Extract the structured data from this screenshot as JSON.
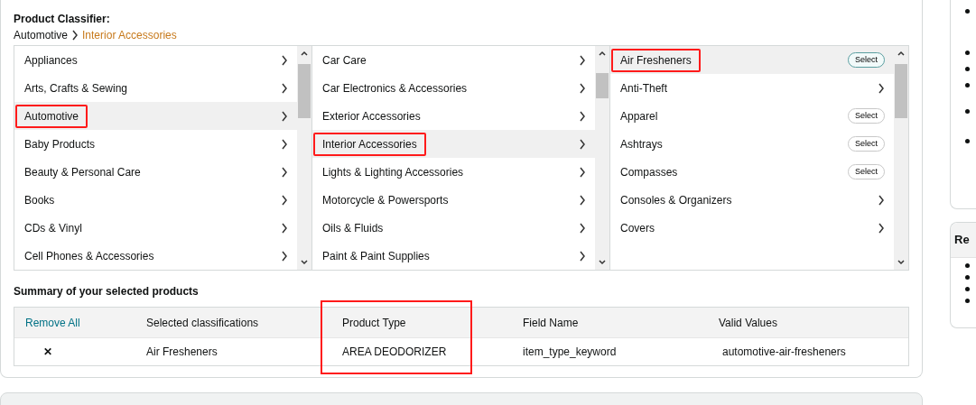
{
  "classifier": {
    "title": "Product Classifier:",
    "breadcrumb": [
      {
        "label": "Automotive",
        "current": false
      },
      {
        "label": "Interior Accessories",
        "current": true
      }
    ],
    "columns": [
      {
        "items": [
          {
            "label": "Appliances",
            "kind": "category",
            "selected": false,
            "highlighted": false
          },
          {
            "label": "Arts, Crafts & Sewing",
            "kind": "category",
            "selected": false,
            "highlighted": false
          },
          {
            "label": "Automotive",
            "kind": "category",
            "selected": true,
            "highlighted": true
          },
          {
            "label": "Baby Products",
            "kind": "category",
            "selected": false,
            "highlighted": false
          },
          {
            "label": "Beauty & Personal Care",
            "kind": "category",
            "selected": false,
            "highlighted": false
          },
          {
            "label": "Books",
            "kind": "category",
            "selected": false,
            "highlighted": false
          },
          {
            "label": "CDs & Vinyl",
            "kind": "category",
            "selected": false,
            "highlighted": false
          },
          {
            "label": "Cell Phones & Accessories",
            "kind": "category",
            "selected": false,
            "highlighted": false
          }
        ]
      },
      {
        "items": [
          {
            "label": "Car Care",
            "kind": "category",
            "selected": false,
            "highlighted": false
          },
          {
            "label": "Car Electronics & Accessories",
            "kind": "category",
            "selected": false,
            "highlighted": false
          },
          {
            "label": "Exterior Accessories",
            "kind": "category",
            "selected": false,
            "highlighted": false
          },
          {
            "label": "Interior Accessories",
            "kind": "category",
            "selected": true,
            "highlighted": true
          },
          {
            "label": "Lights & Lighting Accessories",
            "kind": "category",
            "selected": false,
            "highlighted": false
          },
          {
            "label": "Motorcycle & Powersports",
            "kind": "category",
            "selected": false,
            "highlighted": false
          },
          {
            "label": "Oils & Fluids",
            "kind": "category",
            "selected": false,
            "highlighted": false
          },
          {
            "label": "Paint & Paint Supplies",
            "kind": "category",
            "selected": false,
            "highlighted": false
          }
        ]
      },
      {
        "items": [
          {
            "label": "Air Fresheners",
            "kind": "leaf",
            "button": "Select",
            "selected": true,
            "highlighted": true
          },
          {
            "label": "Anti-Theft",
            "kind": "category",
            "selected": false,
            "highlighted": false
          },
          {
            "label": "Apparel",
            "kind": "leaf",
            "button": "Select",
            "selected": false,
            "highlighted": false
          },
          {
            "label": "Ashtrays",
            "kind": "leaf",
            "button": "Select",
            "selected": false,
            "highlighted": false
          },
          {
            "label": "Compasses",
            "kind": "leaf",
            "button": "Select",
            "selected": false,
            "highlighted": false
          },
          {
            "label": "Consoles & Organizers",
            "kind": "category",
            "selected": false,
            "highlighted": false
          },
          {
            "label": "Covers",
            "kind": "category",
            "selected": false,
            "highlighted": false
          }
        ]
      }
    ]
  },
  "summary": {
    "title": "Summary of your selected products",
    "columns": [
      {
        "label": "Remove All",
        "kind": "link",
        "highlighted": false
      },
      {
        "label": "Selected classifications",
        "kind": "text",
        "highlighted": false
      },
      {
        "label": "Product Type",
        "kind": "text",
        "highlighted": true
      },
      {
        "label": "Field Name",
        "kind": "text",
        "highlighted": false
      },
      {
        "label": "Valid Values",
        "kind": "text",
        "highlighted": false
      }
    ],
    "rows": [
      {
        "remove": "✕",
        "classification": "Air Fresheners",
        "product_type": "AREA DEODORIZER",
        "field_name": "item_type_keyword",
        "valid_values": "automotive-air-fresheners"
      }
    ]
  },
  "sidebar": {
    "second_card_title": "Re"
  }
}
